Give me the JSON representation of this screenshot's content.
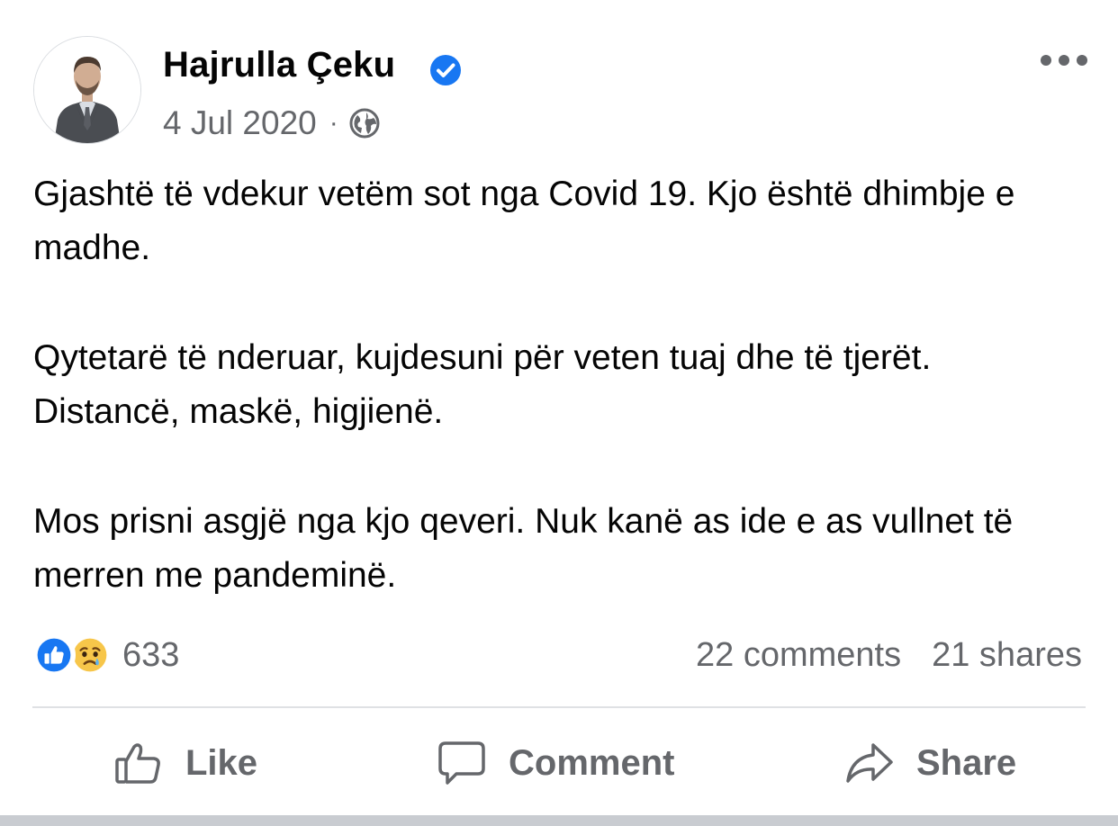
{
  "post": {
    "author": {
      "name": "Hajrulla Çeku",
      "verified_icon": "verified-badge-icon",
      "avatar_icon": "profile-photo"
    },
    "date": "4 Jul 2020",
    "separator": "·",
    "audience_icon": "globe-icon",
    "more_icon": "more-options-icon",
    "paragraphs": [
      "Gjashtë të vdekur vetëm sot nga Covid 19. Kjo është dhimbje e madhe.",
      "Qytetarë të nderuar, kujdesuni për veten tuaj dhe të tjerët. Distancë, maskë, higjienë.",
      "Mos prisni asgjë nga kjo qeveri. Nuk kanë as ide e as vullnet të merren me pandeminë."
    ]
  },
  "stats": {
    "reaction_icons": [
      "like-reaction-icon",
      "sad-reaction-icon"
    ],
    "reaction_count": "633",
    "comments": "22 comments",
    "shares": "21 shares"
  },
  "actions": {
    "like": "Like",
    "comment": "Comment",
    "share": "Share"
  },
  "colors": {
    "text": "#050505",
    "secondary": "#65676b",
    "verified_blue": "#1877f2",
    "divider": "#dfe1e4"
  }
}
